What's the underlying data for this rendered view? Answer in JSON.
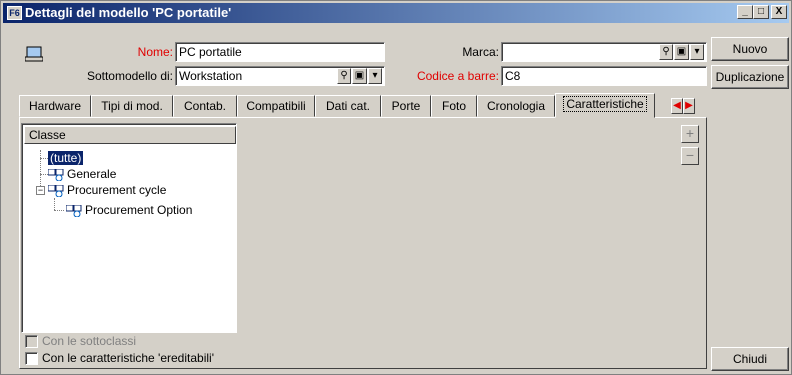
{
  "window": {
    "title": "Dettagli del modello 'PC portatile'",
    "app_icon_label": "F6",
    "controls": {
      "minimize": "_",
      "maximize": "□",
      "close": "X"
    }
  },
  "form": {
    "nome_label": "Nome:",
    "nome_value": "PC portatile",
    "marca_label": "Marca:",
    "marca_value": "",
    "sottomodello_label": "Sottomodello di:",
    "sottomodello_value": "Workstation",
    "codice_label": "Codice a barre:",
    "codice_value": "C8"
  },
  "buttons": {
    "nuovo": "Nuovo",
    "duplicazione": "Duplicazione",
    "chiudi": "Chiudi"
  },
  "tabs": [
    {
      "label": "Hardware"
    },
    {
      "label": "Tipi di mod."
    },
    {
      "label": "Contab."
    },
    {
      "label": "Compatibili"
    },
    {
      "label": "Dati cat."
    },
    {
      "label": "Porte"
    },
    {
      "label": "Foto"
    },
    {
      "label": "Cronologia"
    },
    {
      "label": "Caratteristiche"
    }
  ],
  "active_tab": "Caratteristiche",
  "tree": {
    "header": "Classe",
    "nodes": [
      {
        "label": "(tutte)",
        "selected": true
      },
      {
        "label": "Generale",
        "selected": false
      },
      {
        "label": "Procurement cycle",
        "selected": false
      },
      {
        "label": "Procurement Option",
        "selected": false
      }
    ]
  },
  "side_controls": {
    "add": "+",
    "remove": "−"
  },
  "checkboxes": {
    "sottoclassi": {
      "label": "Con le sottoclassi",
      "checked": false,
      "enabled": false
    },
    "ereditabili": {
      "label": "Con le caratteristiche 'ereditabili'",
      "checked": false,
      "enabled": true
    }
  },
  "colors": {
    "title_bar": "#0a246a",
    "required_label": "#e00000",
    "selection": "#0a246a"
  }
}
